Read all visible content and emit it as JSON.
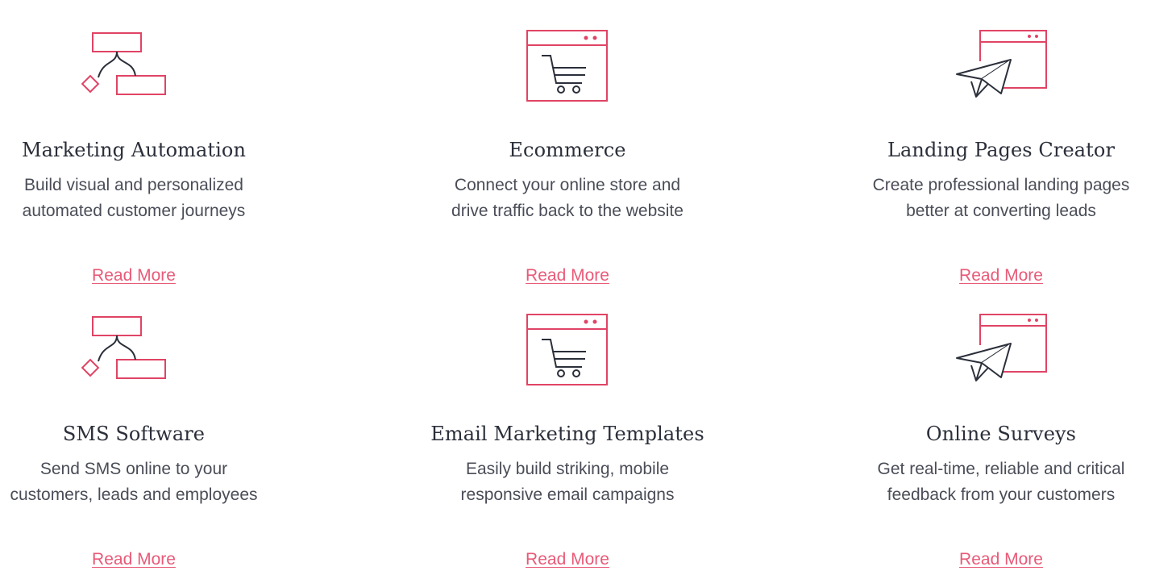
{
  "colors": {
    "accent": "#e04465",
    "link": "#e85a78",
    "title": "#2b2f3a",
    "text": "#4a4d57",
    "icon_dark": "#2b2f3a"
  },
  "features": [
    {
      "icon": "workflow-icon",
      "title": "Marketing Automation",
      "desc_lines": [
        "Build visual and personalized",
        "automated customer journeys"
      ],
      "link": "Read More"
    },
    {
      "icon": "shopping-cart-browser-icon",
      "title": "Ecommerce",
      "desc_lines": [
        "Connect your online store and",
        "drive traffic back to the website"
      ],
      "link": "Read More"
    },
    {
      "icon": "paper-plane-browser-icon",
      "title": "Landing Pages Creator",
      "desc_lines": [
        "Create professional landing pages",
        "better at converting leads"
      ],
      "link": "Read More"
    },
    {
      "icon": "workflow-icon",
      "title": "SMS Software",
      "desc_lines": [
        "Send SMS online to your",
        "customers, leads and employees"
      ],
      "link": "Read More"
    },
    {
      "icon": "shopping-cart-browser-icon",
      "title": "Email Marketing Templates",
      "desc_lines": [
        "Easily build striking, mobile",
        "responsive email campaigns"
      ],
      "link": "Read More"
    },
    {
      "icon": "paper-plane-browser-icon",
      "title": "Online Surveys",
      "desc_lines": [
        "Get real-time, reliable and critical",
        "feedback from your customers"
      ],
      "link": "Read More"
    }
  ]
}
